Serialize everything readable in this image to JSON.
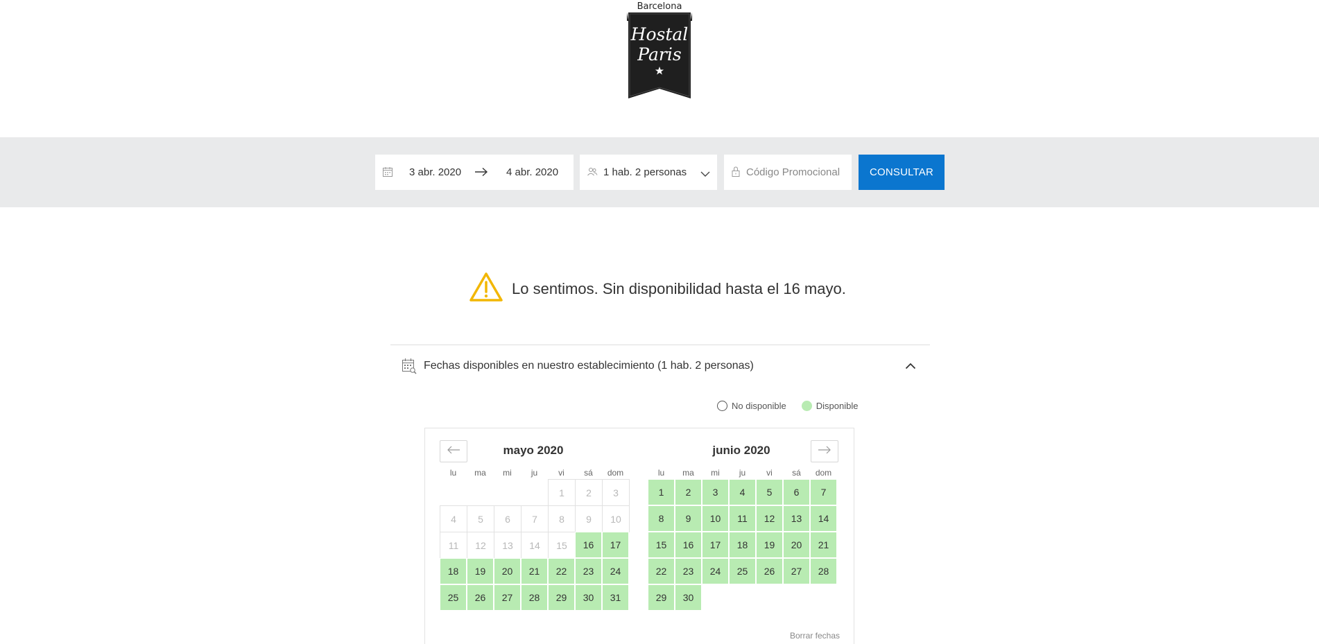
{
  "header": {
    "logo_city": "Barcelona",
    "logo_name_line1": "Hostal",
    "logo_name_line2": "Paris"
  },
  "search": {
    "checkin": "3 abr. 2020",
    "checkout": "4 abr. 2020",
    "guests": "1 hab. 2 personas",
    "promo_placeholder": "Código Promocional",
    "submit_label": "CONSULTAR"
  },
  "alert": {
    "message": "Lo sentimos. Sin disponibilidad hasta el 16 mayo."
  },
  "availability": {
    "title": "Fechas disponibles en nuestro establecimiento (1 hab. 2 personas)",
    "legend_unavailable": "No disponible",
    "legend_available": "Disponible",
    "clear_dates": "Borrar fechas",
    "weekdays": [
      "lu",
      "ma",
      "mi",
      "ju",
      "vi",
      "sá",
      "dom"
    ],
    "months": [
      {
        "title": "mayo 2020",
        "first_weekday_index": 4,
        "days": 31,
        "first_available": 16
      },
      {
        "title": "junio 2020",
        "first_weekday_index": 0,
        "days": 30,
        "first_available": 1
      }
    ]
  },
  "colors": {
    "brand_blue": "#0b76cf",
    "available_green": "#b8ebb2",
    "warning_yellow": "#f2b705",
    "band_gray": "#e9eaeb"
  },
  "icons": [
    "calendar-icon",
    "arrow-right-icon",
    "people-icon",
    "chevron-down-icon",
    "lock-icon",
    "warning-icon",
    "calendar-search-icon",
    "chevron-up-icon",
    "arrow-left-icon"
  ]
}
